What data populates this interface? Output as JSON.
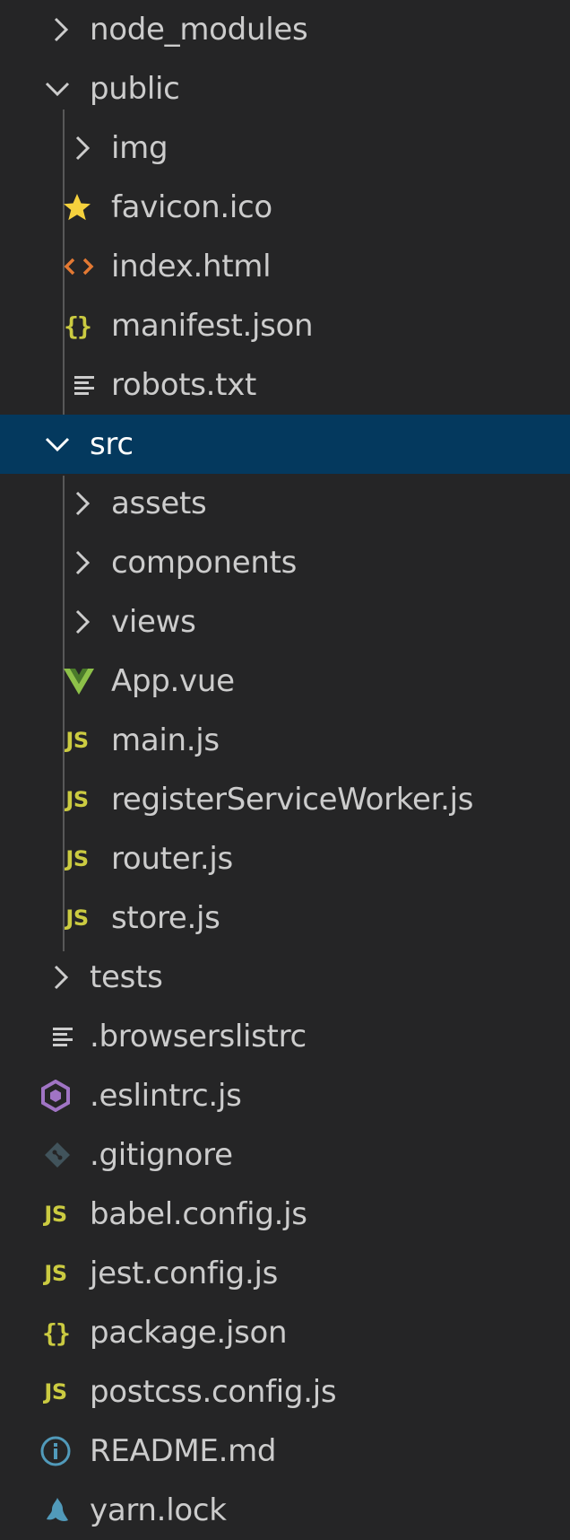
{
  "explorer": {
    "items": [
      {
        "label": "node_modules",
        "type": "folder",
        "expanded": false,
        "icon": "chevron-right-icon"
      },
      {
        "label": "public",
        "type": "folder",
        "expanded": true,
        "icon": "chevron-down-icon"
      },
      {
        "label": "img",
        "type": "folder",
        "expanded": false,
        "icon": "chevron-right-icon"
      },
      {
        "label": "favicon.ico",
        "type": "file",
        "icon": "star-icon"
      },
      {
        "label": "index.html",
        "type": "file",
        "icon": "html-icon"
      },
      {
        "label": "manifest.json",
        "type": "file",
        "icon": "json-icon"
      },
      {
        "label": "robots.txt",
        "type": "file",
        "icon": "text-file-icon"
      },
      {
        "label": "src",
        "type": "folder",
        "expanded": true,
        "selected": true,
        "icon": "chevron-down-icon"
      },
      {
        "label": "assets",
        "type": "folder",
        "expanded": false,
        "icon": "chevron-right-icon"
      },
      {
        "label": "components",
        "type": "folder",
        "expanded": false,
        "icon": "chevron-right-icon"
      },
      {
        "label": "views",
        "type": "folder",
        "expanded": false,
        "icon": "chevron-right-icon"
      },
      {
        "label": "App.vue",
        "type": "file",
        "icon": "vue-icon"
      },
      {
        "label": "main.js",
        "type": "file",
        "icon": "js-icon"
      },
      {
        "label": "registerServiceWorker.js",
        "type": "file",
        "icon": "js-icon"
      },
      {
        "label": "router.js",
        "type": "file",
        "icon": "js-icon"
      },
      {
        "label": "store.js",
        "type": "file",
        "icon": "js-icon"
      },
      {
        "label": "tests",
        "type": "folder",
        "expanded": false,
        "icon": "chevron-right-icon"
      },
      {
        "label": ".browserslistrc",
        "type": "file",
        "icon": "text-file-icon"
      },
      {
        "label": ".eslintrc.js",
        "type": "file",
        "icon": "eslint-icon"
      },
      {
        "label": ".gitignore",
        "type": "file",
        "icon": "git-icon"
      },
      {
        "label": "babel.config.js",
        "type": "file",
        "icon": "js-icon"
      },
      {
        "label": "jest.config.js",
        "type": "file",
        "icon": "js-icon"
      },
      {
        "label": "package.json",
        "type": "file",
        "icon": "json-icon"
      },
      {
        "label": "postcss.config.js",
        "type": "file",
        "icon": "js-icon"
      },
      {
        "label": "README.md",
        "type": "file",
        "icon": "info-icon"
      },
      {
        "label": "yarn.lock",
        "type": "file",
        "icon": "yarn-icon"
      }
    ],
    "icon_glyphs": {
      "js": "JS",
      "json": "{}"
    }
  },
  "colors": {
    "background": "#252526",
    "selection": "#04395e",
    "text": "#cccccc",
    "js": "#cbcb41",
    "html": "#e37933",
    "vue": "#8dc149",
    "eslint": "#a074c4",
    "git": "#41535b",
    "info": "#519aba",
    "yarn": "#519aba",
    "star": "#f5d13d"
  }
}
